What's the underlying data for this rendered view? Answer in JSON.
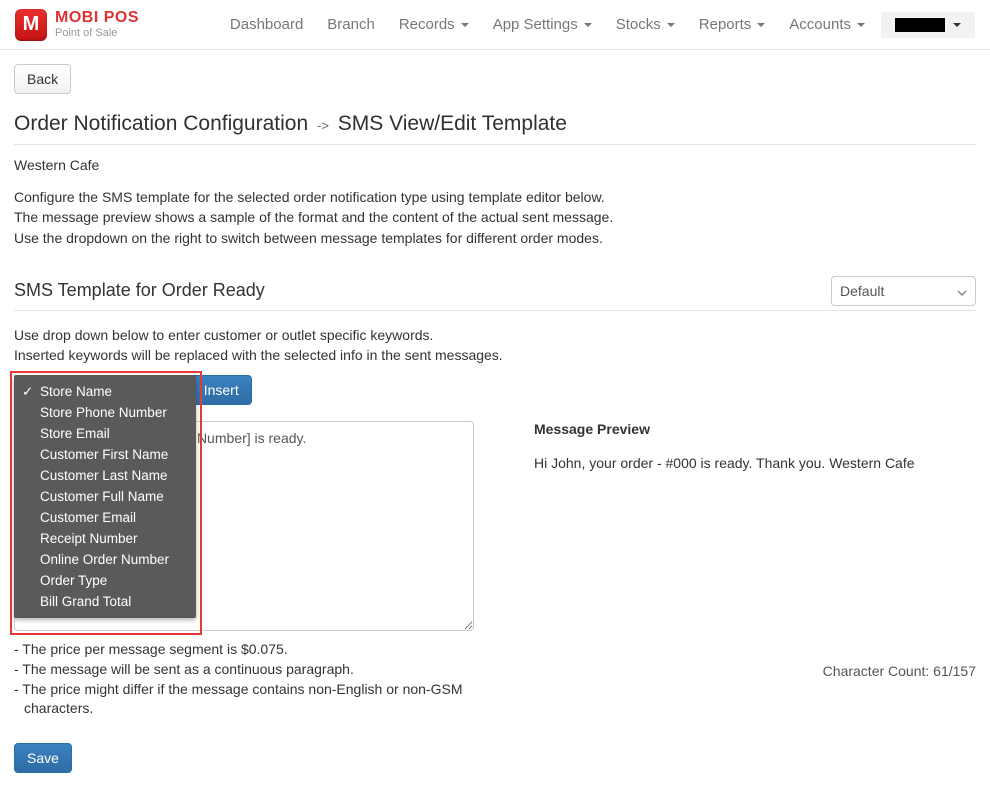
{
  "brand": {
    "logo_letter": "M",
    "name": "MOBI POS",
    "subtitle": "Point of Sale"
  },
  "nav": {
    "dashboard": "Dashboard",
    "branch": "Branch",
    "records": "Records",
    "app_settings": "App Settings",
    "stocks": "Stocks",
    "reports": "Reports",
    "accounts": "Accounts"
  },
  "back_label": "Back",
  "title_main": "Order Notification Configuration",
  "title_sep": "->",
  "title_sub": "SMS View/Edit Template",
  "outlet_name": "Western Cafe",
  "desc_line1": "Configure the SMS template for the selected order notification type using template editor below.",
  "desc_line2": "The message preview shows a sample of the format and the content of the actual sent message.",
  "desc_line3": "Use the dropdown on the right to switch between message templates for different order modes.",
  "section_title": "SMS Template for Order Ready",
  "mode_select": {
    "value": "Default"
  },
  "helper_line1": "Use drop down below to enter customer or outlet specific keywords.",
  "helper_line2": "Inserted keywords will be replaced with the selected info in the sent messages.",
  "keyword_dropdown": {
    "selected_index": 0,
    "options": [
      "Store Name",
      "Store Phone Number",
      "Store Email",
      "Customer First Name",
      "Customer Last Name",
      "Customer Full Name",
      "Customer Email",
      "Receipt Number",
      "Online Order Number",
      "Order Type",
      "Bill Grand Total"
    ]
  },
  "insert_label": "Insert",
  "template_value": ", your order - [Online Order Number] is ready.",
  "preview_heading": "Message Preview",
  "preview_text": "Hi John, your order - #000 is ready. Thank you. Western Cafe",
  "notes": {
    "n1": "- The price per message segment is $0.075.",
    "n2": "- The message will be sent as a continuous paragraph.",
    "n3a": "- The price might differ if the message contains non-English or non-GSM",
    "n3b": "characters."
  },
  "char_count_label": "Character Count: 61/157",
  "save_label": "Save"
}
